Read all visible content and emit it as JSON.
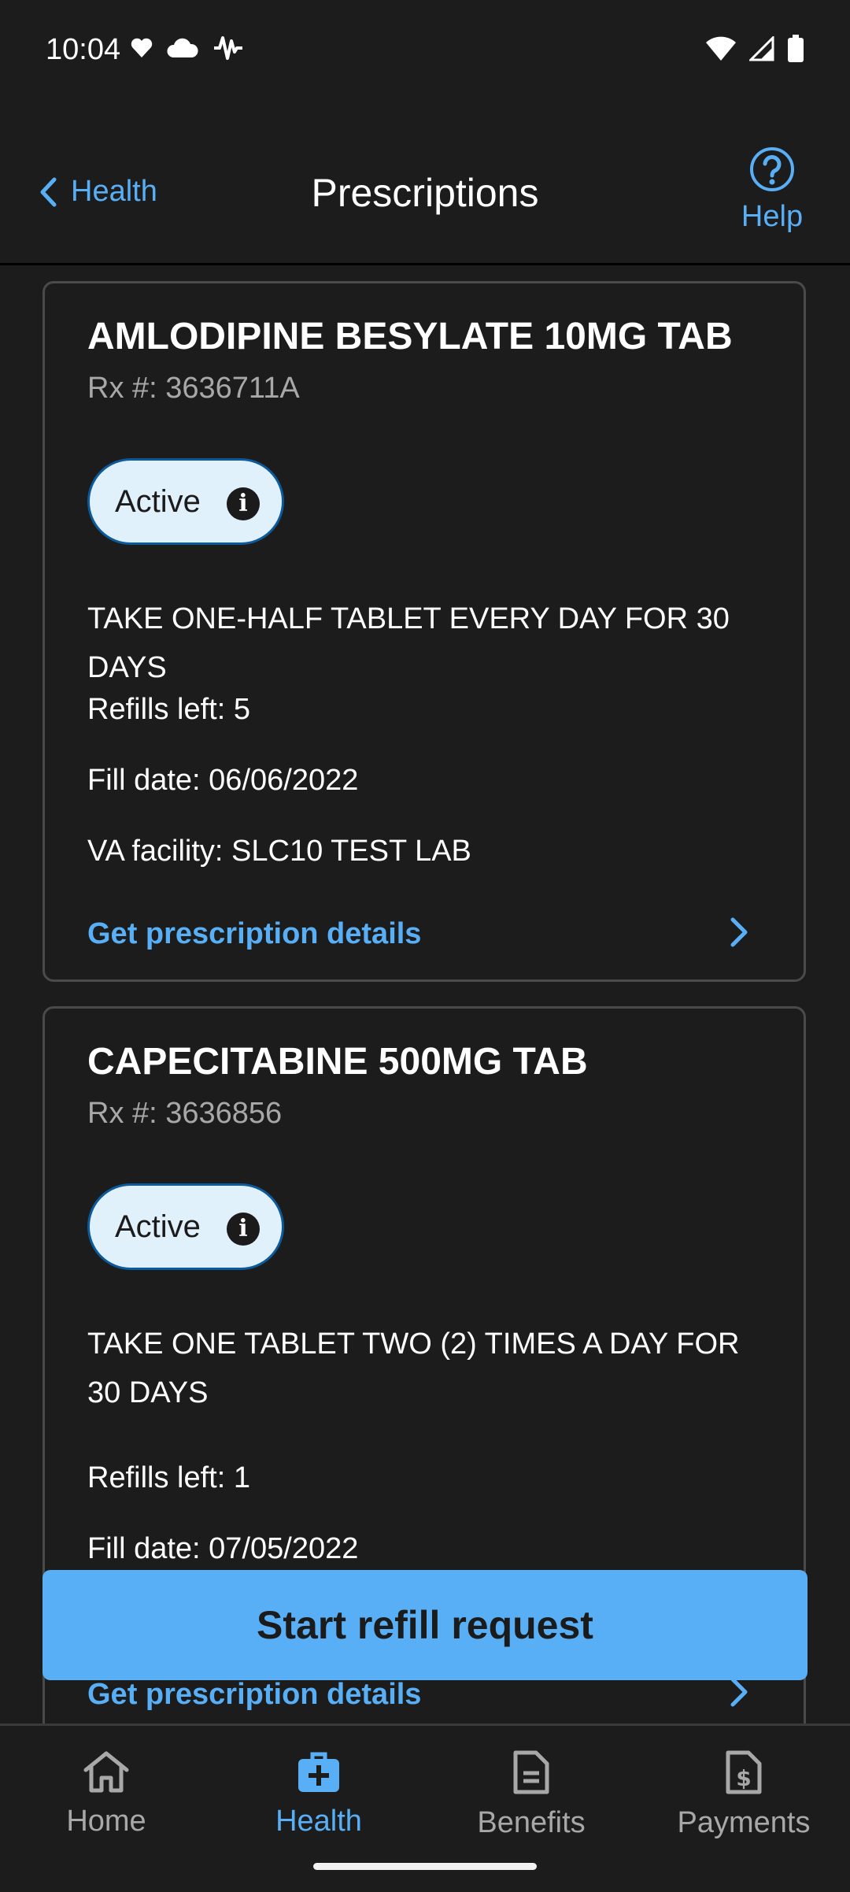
{
  "status_bar": {
    "time": "10:04"
  },
  "header": {
    "back_label": "Health",
    "title": "Prescriptions",
    "help_label": "Help"
  },
  "prescriptions": [
    {
      "name": "AMLODIPINE BESYLATE 10MG TAB",
      "rx": "Rx #: 3636711A",
      "status": "Active",
      "instructions": "TAKE ONE-HALF TABLET EVERY DAY FOR 30 DAYS",
      "refills": "Refills left: 5",
      "fill_date": "Fill date: 06/06/2022",
      "facility": "VA facility: SLC10 TEST LAB",
      "details_link": "Get prescription details"
    },
    {
      "name": "CAPECITABINE 500MG TAB",
      "rx": "Rx #: 3636856",
      "status": "Active",
      "instructions": "TAKE ONE TABLET TWO (2) TIMES A DAY FOR 30 DAYS",
      "refills": "Refills left: 1",
      "fill_date": "Fill date: 07/05/2022",
      "details_link": "Get prescription details"
    }
  ],
  "refill_button": "Start refill request",
  "tabs": [
    {
      "label": "Home",
      "icon": "home-icon"
    },
    {
      "label": "Health",
      "icon": "medical-kit-icon",
      "active": true
    },
    {
      "label": "Benefits",
      "icon": "document-icon"
    },
    {
      "label": "Payments",
      "icon": "payment-document-icon"
    }
  ],
  "colors": {
    "background": "#1c1c1c",
    "accent": "#58aff6",
    "pill": "#e1f1fb"
  }
}
